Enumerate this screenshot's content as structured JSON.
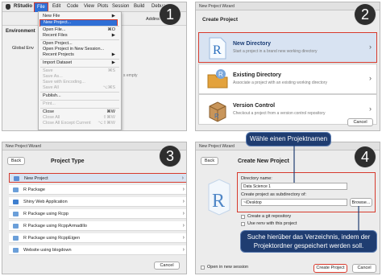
{
  "steps": [
    "1",
    "2",
    "3",
    "4"
  ],
  "panel1": {
    "menubar": [
      "RStudio",
      "File",
      "Edit",
      "Code",
      "View",
      "Plots",
      "Session",
      "Build",
      "Debug"
    ],
    "menu_items": [
      {
        "label": "New File",
        "shortcut": "▶",
        "disabled": false
      },
      {
        "label": "New Project...",
        "shortcut": "",
        "disabled": false,
        "highlight": true
      },
      {
        "sep": true
      },
      {
        "label": "Open File...",
        "shortcut": "⌘O",
        "disabled": false
      },
      {
        "label": "Recent Files",
        "shortcut": "▶",
        "disabled": false
      },
      {
        "sep": true
      },
      {
        "label": "Open Project...",
        "shortcut": "",
        "disabled": false
      },
      {
        "label": "Open Project in New Session...",
        "shortcut": "",
        "disabled": false
      },
      {
        "label": "Recent Projects",
        "shortcut": "▶",
        "disabled": false
      },
      {
        "sep": true
      },
      {
        "label": "Import Dataset",
        "shortcut": "▶",
        "disabled": false
      },
      {
        "sep": true
      },
      {
        "label": "Save",
        "shortcut": "⌘S",
        "disabled": true
      },
      {
        "label": "Save As...",
        "shortcut": "",
        "disabled": true
      },
      {
        "label": "Save with Encoding...",
        "shortcut": "",
        "disabled": true
      },
      {
        "label": "Save All",
        "shortcut": "⌥⌘S",
        "disabled": true
      },
      {
        "sep": true
      },
      {
        "label": "Publish...",
        "shortcut": "",
        "disabled": false
      },
      {
        "sep": true
      },
      {
        "label": "Print...",
        "shortcut": "",
        "disabled": true
      },
      {
        "sep": true
      },
      {
        "label": "Close",
        "shortcut": "⌘W",
        "disabled": false
      },
      {
        "label": "Close All",
        "shortcut": "⇧⌘W",
        "disabled": true
      },
      {
        "label": "Close All Except Current",
        "shortcut": "⌥⇧⌘W",
        "disabled": true
      }
    ],
    "env_label": "Environment",
    "global_env": "Global Env",
    "addins": "Addins",
    "empty_text": "s empty"
  },
  "panel2": {
    "title": "New Project Wizard",
    "heading": "Create Project",
    "options": [
      {
        "title": "New Directory",
        "sub": "Start a project in a brand new working directory"
      },
      {
        "title": "Existing Directory",
        "sub": "Associate a project with an existing working directory"
      },
      {
        "title": "Version Control",
        "sub": "Checkout a project from a version control repository"
      }
    ],
    "cancel": "Cancel"
  },
  "panel3": {
    "title": "New Project Wizard",
    "back": "Back",
    "heading": "Project Type",
    "items": [
      "New Project",
      "R Package",
      "Shiny Web Application",
      "R Package using Rcpp",
      "R Package using RcppArmadillo",
      "R Package using RcppEigen",
      "Website using blogdown"
    ],
    "cancel": "Cancel"
  },
  "panel4": {
    "title": "New Project Wizard",
    "back": "Back",
    "heading": "Create New Project",
    "dir_label": "Directory name:",
    "dir_value": "Data Science 1",
    "sub_label": "Create project as subdirectory of:",
    "sub_value": "~/Desktop",
    "browse": "Browse...",
    "git": "Create a git repository",
    "renv": "Use renv with this project",
    "open_new": "Open in new session",
    "create": "Create Project",
    "cancel": "Cancel",
    "bubble_top": "Wähle einen Projektnamen",
    "bubble_bottom": "Suche hierüber das Verzeichnis, indem der Projektordner gespeichert werden soll."
  },
  "colors": {
    "highlight_red": "#d73a2d",
    "bubble_navy": "#1f3d71",
    "selection_blue": "#2f6fd6"
  }
}
